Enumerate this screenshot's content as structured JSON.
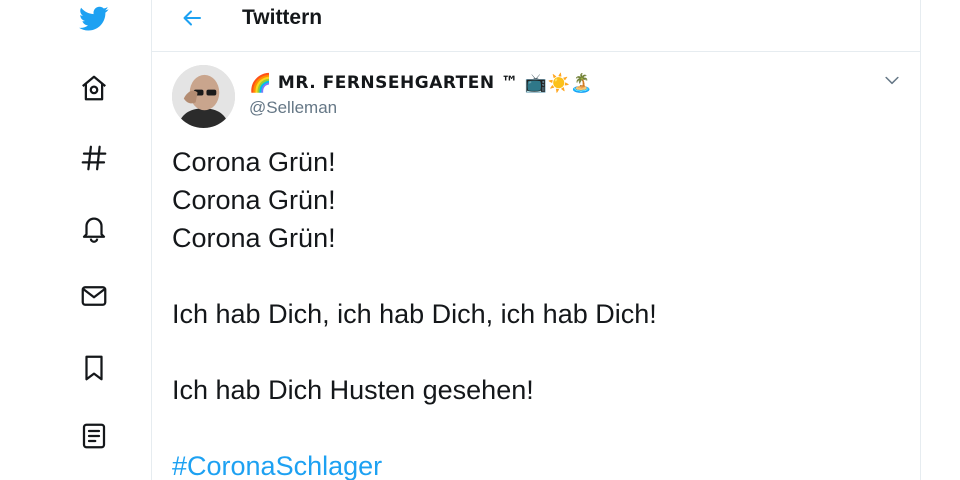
{
  "header": {
    "title": "Twittern"
  },
  "sidebar": {
    "items": [
      {
        "icon": "twitter-logo-icon"
      },
      {
        "icon": "home-icon"
      },
      {
        "icon": "explore-hashtag-icon"
      },
      {
        "icon": "notifications-bell-icon"
      },
      {
        "icon": "messages-envelope-icon"
      },
      {
        "icon": "bookmarks-icon"
      },
      {
        "icon": "lists-icon"
      }
    ]
  },
  "tweet": {
    "display_name": "MR. FERNSEHGARTEN ™",
    "name_prefix_emoji": "🌈",
    "name_suffix_emoji": "📺☀️🏝️",
    "handle": "@Selleman",
    "lines": {
      "l1": "Corona Grün!",
      "l2": "Corona Grün!",
      "l3": "Corona Grün!",
      "l4": "Ich hab Dich, ich hab Dich, ich hab Dich!",
      "l5": "Ich hab Dich Husten gesehen!"
    },
    "hashtag": "#CoronaSchlager"
  },
  "colors": {
    "brand": "#1da1f2",
    "text": "#14171a",
    "secondary": "#657786",
    "border": "#e6ecf0"
  }
}
